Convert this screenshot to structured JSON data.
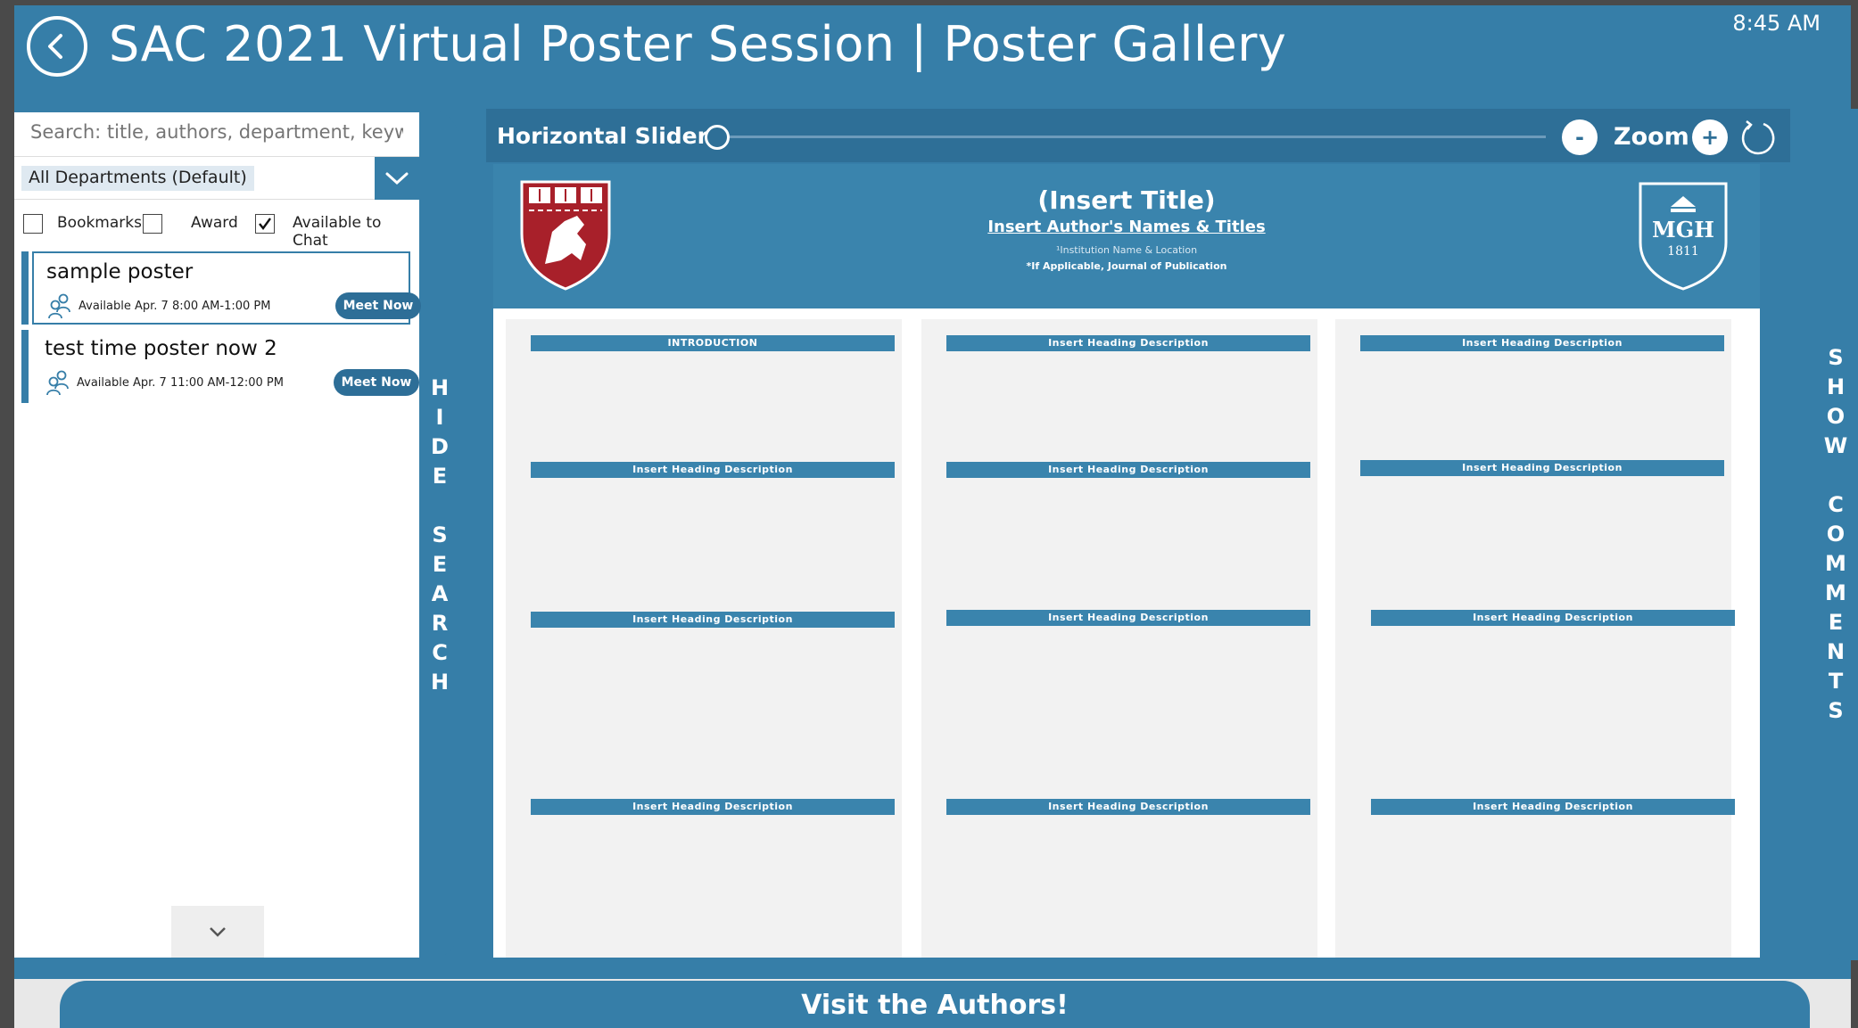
{
  "header": {
    "title": "SAC 2021 Virtual Poster Session | Poster Gallery",
    "time": "8:45 AM"
  },
  "search": {
    "placeholder": "Search: title, authors, department, keyword"
  },
  "department_select": {
    "selected": "All Departments (Default)"
  },
  "filters": [
    {
      "label": "Bookmarks",
      "checked": false
    },
    {
      "label": "Award",
      "checked": false
    },
    {
      "label": "Available to Chat",
      "checked": true
    }
  ],
  "posters": [
    {
      "title": "sample poster",
      "availability": "Available Apr. 7 8:00 AM-1:00 PM",
      "button": "Meet Now",
      "selected": true
    },
    {
      "title": "test time poster now 2",
      "availability": "Available Apr. 7 11:00 AM-12:00 PM",
      "button": "Meet Now",
      "selected": false
    }
  ],
  "hide_search_label": [
    "H",
    "I",
    "D",
    "E",
    "",
    "S",
    "E",
    "A",
    "R",
    "C",
    "H"
  ],
  "toolbar": {
    "slider_label": "Horizontal Slider",
    "slider_value": 0,
    "zoom_minus": "-",
    "zoom_label": "Zoom",
    "zoom_plus": "+"
  },
  "poster": {
    "title": "(Insert Title)",
    "authors": "Insert Author's Names & Titles",
    "institution": "¹Institution Name & Location",
    "journal": "*If Applicable, Journal of Publication",
    "mgh_logo_text": "MGH",
    "mgh_logo_year": "1811",
    "columns": [
      [
        "INTRODUCTION",
        "Insert Heading Description",
        "Insert Heading Description",
        "Insert Heading Description"
      ],
      [
        "Insert Heading Description",
        "Insert Heading Description",
        "Insert Heading Description",
        "Insert Heading Description"
      ],
      [
        "Insert Heading Description",
        "Insert Heading Description",
        "Insert Heading Description",
        "Insert Heading Description"
      ]
    ]
  },
  "show_comments_label": [
    "S",
    "H",
    "O",
    "W",
    "",
    "C",
    "O",
    "M",
    "M",
    "E",
    "N",
    "T",
    "S"
  ],
  "footer": {
    "visit_label": "Visit the Authors!"
  },
  "colors": {
    "brand_blue": "#367ea8",
    "toolbar_blue": "#2e6f97",
    "poster_blue": "#3a84ad"
  }
}
